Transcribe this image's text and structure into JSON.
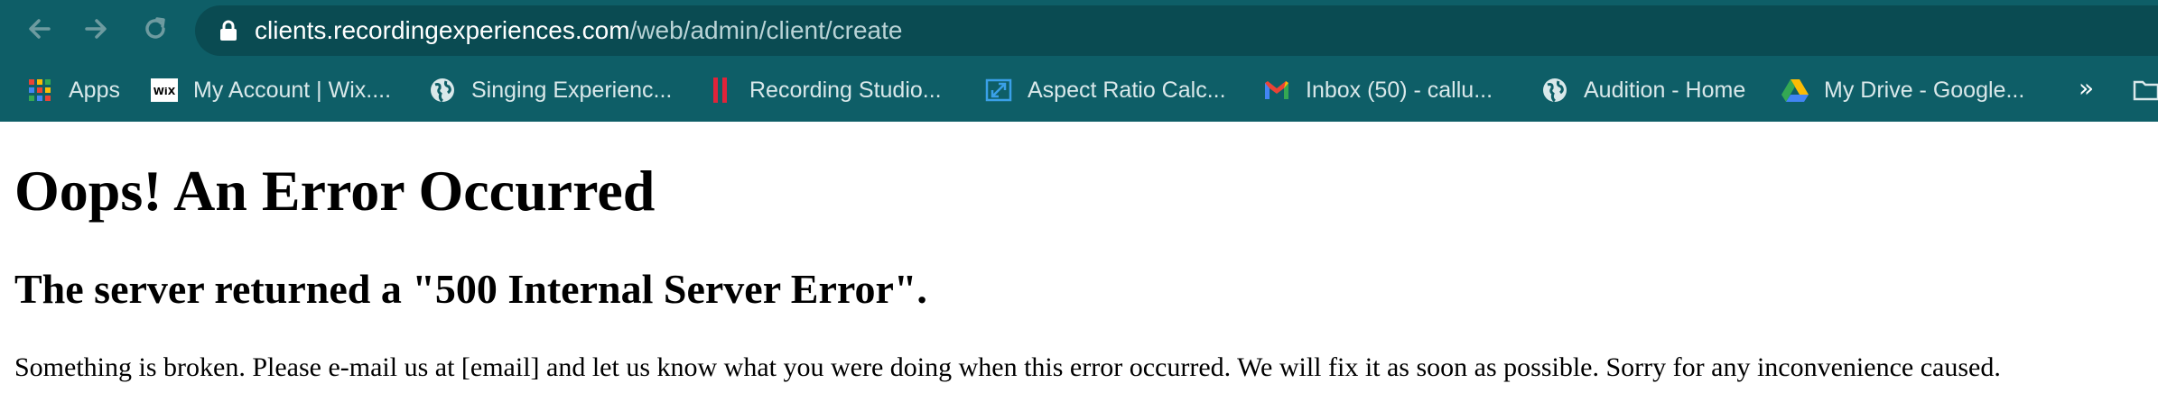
{
  "browser": {
    "url_host": "clients.recordingexperiences.com",
    "url_path": "/web/admin/client/create",
    "nav": {
      "back_icon": "arrow-left-icon",
      "forward_icon": "arrow-right-icon",
      "reload_icon": "reload-icon",
      "lock_icon": "lock-icon"
    },
    "bookmarks": [
      {
        "label": "Apps",
        "icon": "apps-grid-icon"
      },
      {
        "label": "My Account | Wix....",
        "icon": "wix-icon"
      },
      {
        "label": "Singing Experienc...",
        "icon": "globe-icon"
      },
      {
        "label": "Recording Studio...",
        "icon": "red-bars-icon"
      },
      {
        "label": "Aspect Ratio Calc...",
        "icon": "expand-icon"
      },
      {
        "label": "Inbox (50) - callu...",
        "icon": "gmail-icon"
      },
      {
        "label": "Audition - Home",
        "icon": "globe-icon"
      },
      {
        "label": "My Drive - Google...",
        "icon": "google-drive-icon"
      }
    ],
    "overflow_label": "»",
    "colors": {
      "toolbar_bg": "#0e5e67",
      "omnibox_bg": "#0a4b52"
    }
  },
  "page": {
    "heading": "Oops! An Error Occurred",
    "subheading": "The server returned a \"500 Internal Server Error\".",
    "message": "Something is broken. Please e-mail us at [email] and let us know what you were doing when this error occurred. We will fix it as soon as possible. Sorry for any inconvenience caused."
  }
}
